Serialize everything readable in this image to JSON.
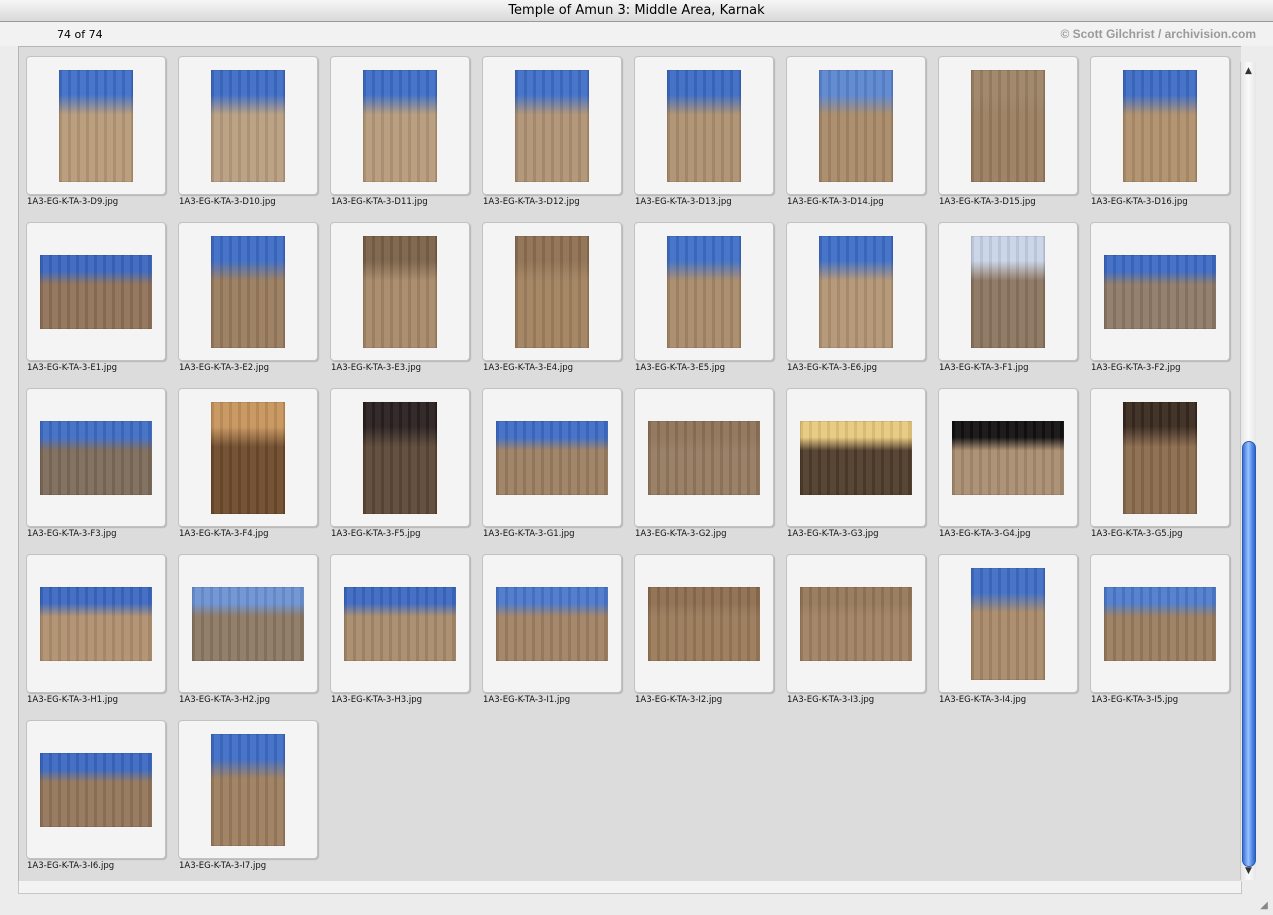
{
  "window": {
    "title": "Temple of Amun 3: Middle Area, Karnak",
    "count": "74 of 74",
    "credit": "© Scott Gilchrist / archivision.com"
  },
  "icons": {
    "scroll_up": "triangle-up-icon",
    "scroll_down": "triangle-down-icon",
    "resize": "resize-grip-icon"
  },
  "thumbnails": [
    {
      "name": "1A3-EG-K-TA-3-D9.jpg",
      "orientation": "portrait",
      "sky": "#3f6fc8",
      "stone": "#b79a78"
    },
    {
      "name": "1A3-EG-K-TA-3-D10.jpg",
      "orientation": "portrait",
      "sky": "#3d6cc6",
      "stone": "#b89e80"
    },
    {
      "name": "1A3-EG-K-TA-3-D11.jpg",
      "orientation": "portrait",
      "sky": "#3e6ec7",
      "stone": "#b69b7a"
    },
    {
      "name": "1A3-EG-K-TA-3-D12.jpg",
      "orientation": "portrait",
      "sky": "#3f6fc8",
      "stone": "#b09274"
    },
    {
      "name": "1A3-EG-K-TA-3-D13.jpg",
      "orientation": "portrait",
      "sky": "#3c6bc4",
      "stone": "#ad9070"
    },
    {
      "name": "1A3-EG-K-TA-3-D14.jpg",
      "orientation": "portrait",
      "sky": "#5b86d0",
      "stone": "#a88a68"
    },
    {
      "name": "1A3-EG-K-TA-3-D15.jpg",
      "orientation": "portrait",
      "sky": "#9e8466",
      "stone": "#9a7e60"
    },
    {
      "name": "1A3-EG-K-TA-3-D16.jpg",
      "orientation": "portrait",
      "sky": "#3d6cc6",
      "stone": "#b08f6c"
    },
    {
      "name": "1A3-EG-K-TA-3-E1.jpg",
      "orientation": "landscape",
      "sky": "#3b66c0",
      "stone": "#8f7257"
    },
    {
      "name": "1A3-EG-K-TA-3-E2.jpg",
      "orientation": "portrait",
      "sky": "#3d6cc6",
      "stone": "#9a7c5e"
    },
    {
      "name": "1A3-EG-K-TA-3-E3.jpg",
      "orientation": "portrait",
      "sky": "#7a6248",
      "stone": "#a88868"
    },
    {
      "name": "1A3-EG-K-TA-3-E4.jpg",
      "orientation": "portrait",
      "sky": "#8f7052",
      "stone": "#a1825f"
    },
    {
      "name": "1A3-EG-K-TA-3-E5.jpg",
      "orientation": "portrait",
      "sky": "#3f6fc8",
      "stone": "#a98a69"
    },
    {
      "name": "1A3-EG-K-TA-3-E6.jpg",
      "orientation": "portrait",
      "sky": "#3e6ec7",
      "stone": "#b39474"
    },
    {
      "name": "1A3-EG-K-TA-3-F1.jpg",
      "orientation": "portrait",
      "sky": "#c9d4e8",
      "stone": "#8b7560"
    },
    {
      "name": "1A3-EG-K-TA-3-F2.jpg",
      "orientation": "landscape",
      "sky": "#3c6ac4",
      "stone": "#8e7a68"
    },
    {
      "name": "1A3-EG-K-TA-3-F3.jpg",
      "orientation": "landscape",
      "sky": "#3f6ec6",
      "stone": "#7d6b5a"
    },
    {
      "name": "1A3-EG-K-TA-3-F4.jpg",
      "orientation": "portrait",
      "sky": "#c7955d",
      "stone": "#6e4a2c"
    },
    {
      "name": "1A3-EG-K-TA-3-F5.jpg",
      "orientation": "portrait",
      "sky": "#2a2020",
      "stone": "#5c4838"
    },
    {
      "name": "1A3-EG-K-TA-3-G1.jpg",
      "orientation": "landscape",
      "sky": "#3e6dc6",
      "stone": "#9c7f62"
    },
    {
      "name": "1A3-EG-K-TA-3-G2.jpg",
      "orientation": "landscape",
      "sky": "#8f7358",
      "stone": "#957a60"
    },
    {
      "name": "1A3-EG-K-TA-3-G3.jpg",
      "orientation": "landscape",
      "sky": "#e8c97e",
      "stone": "#4f3c2c"
    },
    {
      "name": "1A3-EG-K-TA-3-G4.jpg",
      "orientation": "landscape",
      "sky": "#121010",
      "stone": "#a98d70"
    },
    {
      "name": "1A3-EG-K-TA-3-G5.jpg",
      "orientation": "portrait",
      "sky": "#3a2a20",
      "stone": "#8a6a4c"
    },
    {
      "name": "1A3-EG-K-TA-3-H1.jpg",
      "orientation": "landscape",
      "sky": "#3b68c2",
      "stone": "#b09070"
    },
    {
      "name": "1A3-EG-K-TA-3-H2.jpg",
      "orientation": "landscape",
      "sky": "#6d93d4",
      "stone": "#8c7864"
    },
    {
      "name": "1A3-EG-K-TA-3-H3.jpg",
      "orientation": "landscape",
      "sky": "#3c69c3",
      "stone": "#a98b6c"
    },
    {
      "name": "1A3-EG-K-TA-3-I1.jpg",
      "orientation": "landscape",
      "sky": "#4a78cc",
      "stone": "#a18264"
    },
    {
      "name": "1A3-EG-K-TA-3-I2.jpg",
      "orientation": "landscape",
      "sky": "#8e6e50",
      "stone": "#9a7a5a"
    },
    {
      "name": "1A3-EG-K-TA-3-I3.jpg",
      "orientation": "landscape",
      "sky": "#96785a",
      "stone": "#a08263"
    },
    {
      "name": "1A3-EG-K-TA-3-I4.jpg",
      "orientation": "portrait",
      "sky": "#3f6ec6",
      "stone": "#a98a69"
    },
    {
      "name": "1A3-EG-K-TA-3-I5.jpg",
      "orientation": "landscape",
      "sky": "#4e7ccd",
      "stone": "#9b7d5f"
    },
    {
      "name": "1A3-EG-K-TA-3-I6.jpg",
      "orientation": "landscape",
      "sky": "#3b68c2",
      "stone": "#94765a"
    },
    {
      "name": "1A3-EG-K-TA-3-I7.jpg",
      "orientation": "portrait",
      "sky": "#3e6dc6",
      "stone": "#9d7e5f"
    }
  ]
}
